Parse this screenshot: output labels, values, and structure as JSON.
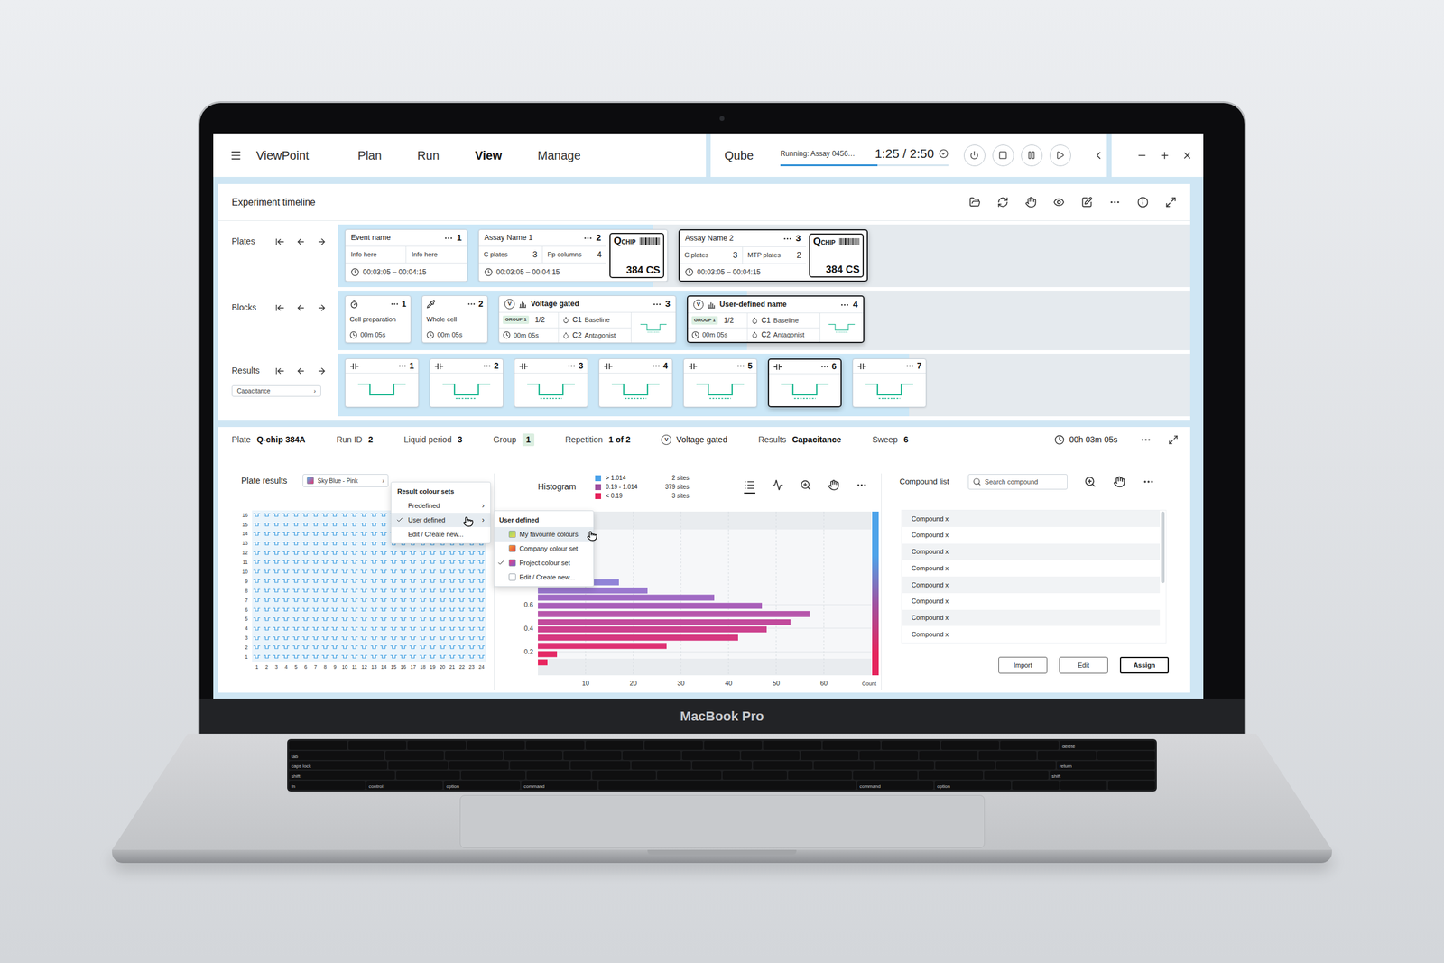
{
  "device": {
    "label": "MacBook Pro"
  },
  "keyboard": {
    "rows": [
      [
        "",
        "",
        "",
        "",
        "",
        "",
        "",
        "",
        "",
        "",
        "",
        "",
        "",
        "delete"
      ],
      [
        "tab",
        "",
        "",
        "",
        "",
        "",
        "",
        "",
        "",
        "",
        "",
        "",
        "",
        ""
      ],
      [
        "caps lock",
        "",
        "",
        "",
        "",
        "",
        "",
        "",
        "",
        "",
        "",
        "",
        "return"
      ],
      [
        "shift",
        "",
        "",
        "",
        "",
        "",
        "",
        "",
        "",
        "",
        "",
        "shift"
      ],
      [
        "fn",
        "control",
        "option",
        "command",
        "",
        "command",
        "option",
        "",
        "",
        ""
      ]
    ]
  },
  "topbar": {
    "app_name": "ViewPoint",
    "nav": [
      {
        "label": "Plan",
        "selected": false
      },
      {
        "label": "Run",
        "selected": false
      },
      {
        "label": "View",
        "selected": true
      },
      {
        "label": "Manage",
        "selected": false
      }
    ],
    "instrument": "Qube",
    "running": {
      "text": "Running: Assay 0456…",
      "level": 0.58
    },
    "time": "1:25 / 2:50"
  },
  "timeline": {
    "title": "Experiment timeline",
    "plates": {
      "label": "Plates",
      "progress": 0.37,
      "cards": [
        {
          "kind": "event",
          "title": "Event name",
          "number": "1",
          "info": [
            "Info here",
            "Info here"
          ],
          "time": "00:03:05 – 00:04:15",
          "selected": false
        },
        {
          "kind": "assay",
          "title": "Assay Name 1",
          "number": "2",
          "stats": [
            {
              "label": "C plates",
              "value": "3"
            },
            {
              "label": "Pp columns",
              "value": "4"
            }
          ],
          "time": "00:03:05 – 00:04:15",
          "chip": {
            "brand": [
              "Q",
              "CHIP"
            ],
            "label": "384 CS"
          },
          "selected": false
        },
        {
          "kind": "assay",
          "title": "Assay Name 2",
          "number": "3",
          "stats": [
            {
              "label": "C plates",
              "value": "3"
            },
            {
              "label": "MTP plates",
              "value": "2"
            }
          ],
          "time": "00:03:05 – 00:04:15",
          "chip": {
            "brand": [
              "Q",
              "CHIP"
            ],
            "label": "384 CS"
          },
          "selected": true
        }
      ]
    },
    "blocks": {
      "label": "Blocks",
      "progress": 0.48,
      "cards": [
        {
          "kind": "prep",
          "title": "Cell preparation",
          "number": "1",
          "duration": "00m 05s",
          "selected": false
        },
        {
          "kind": "patch",
          "title": "Whole cell",
          "number": "2",
          "duration": "00m 05s",
          "selected": false
        },
        {
          "kind": "assay",
          "badge": "V",
          "title": "Voltage gated",
          "number": "3",
          "group": "GROUP 1",
          "fraction": "1/2",
          "compounds": [
            {
              "id": "C1",
              "name": "Baseline"
            },
            {
              "id": "C2",
              "name": "Antagonist"
            }
          ],
          "duration": "00m 05s",
          "dashed": true,
          "selected": false
        },
        {
          "kind": "assay",
          "badge": "V",
          "title": "User-defined name",
          "number": "4",
          "group": "GROUP 1",
          "fraction": "1/2",
          "compounds": [
            {
              "id": "C1",
              "name": "Baseline"
            },
            {
              "id": "C2",
              "name": "Antagonist"
            }
          ],
          "duration": "00m 05s",
          "dashed": true,
          "selected": true
        }
      ]
    },
    "results": {
      "label": "Results",
      "progress": 0.67,
      "selector": {
        "label": "Capacitance",
        "arrow": "›"
      },
      "cards": [
        {
          "number": "1",
          "dashed": false,
          "selected": false
        },
        {
          "number": "2",
          "dashed": true,
          "selected": false
        },
        {
          "number": "3",
          "dashed": true,
          "selected": false
        },
        {
          "number": "4",
          "dashed": true,
          "selected": false
        },
        {
          "number": "5",
          "dashed": true,
          "selected": false
        },
        {
          "number": "6",
          "dashed": true,
          "selected": true
        },
        {
          "number": "7",
          "dashed": true,
          "selected": false
        }
      ]
    }
  },
  "plate_view": {
    "fields": [
      {
        "kind": "pair",
        "label": "Plate",
        "value": "Q-chip 384A"
      },
      {
        "kind": "pair",
        "label": "Run ID",
        "value": "2"
      },
      {
        "kind": "pair",
        "label": "Liquid period",
        "value": "3"
      },
      {
        "kind": "badge",
        "label": "Group",
        "value": "1"
      },
      {
        "kind": "pair",
        "label": "Repetition",
        "value": "1 of 2"
      },
      {
        "kind": "mode",
        "badge": "V",
        "value": "Voltage gated"
      },
      {
        "kind": "pair",
        "label": "Results",
        "value": "Capacitance"
      },
      {
        "kind": "pair",
        "label": "Sweep",
        "value": "6"
      }
    ],
    "duration": "00h 03m 05s"
  },
  "plate_results": {
    "title": "Plate results",
    "colour_set": {
      "label": "Sky Blue - Pink",
      "arrow": "›",
      "swatch": [
        "#5aaeea",
        "#e5326e"
      ]
    },
    "rows": [
      "16",
      "15",
      "14",
      "13",
      "12",
      "11",
      "10",
      "9",
      "8",
      "7",
      "6",
      "5",
      "4",
      "3",
      "2",
      "1"
    ],
    "columns": [
      "1",
      "2",
      "3",
      "4",
      "5",
      "6",
      "7",
      "8",
      "9",
      "10",
      "11",
      "12",
      "13",
      "14",
      "15",
      "16",
      "17",
      "18",
      "19",
      "20",
      "21",
      "22",
      "23",
      "24"
    ]
  },
  "colour_menu": {
    "title": "Result colour sets",
    "items": [
      {
        "label": "Predefined",
        "arrow": "›",
        "checked": false,
        "highlighted": false
      },
      {
        "label": "User defined",
        "arrow": "›",
        "checked": true,
        "highlighted": true
      },
      {
        "label": "Edit / Create new...",
        "arrow": "",
        "checked": false,
        "highlighted": false
      }
    ]
  },
  "colour_submenu": {
    "title": "User defined",
    "items": [
      {
        "label": "My favourite colours",
        "checked": false,
        "highlighted": true,
        "swatch": [
          "#8fd46b",
          "#f3dc4f"
        ]
      },
      {
        "label": "Company colour set",
        "checked": false,
        "highlighted": false,
        "swatch": [
          "#f6a03a",
          "#e23d3d"
        ]
      },
      {
        "label": "Project colour set",
        "checked": true,
        "highlighted": false,
        "swatch": [
          "#ea3f78",
          "#7b5fd3"
        ]
      },
      {
        "label": "Edit / Create new...",
        "checked": false,
        "highlighted": false,
        "swatch": []
      }
    ]
  },
  "histogram": {
    "title": "Histogram",
    "legend": [
      {
        "range": "> 1.014",
        "count": "2 sites",
        "color": "#4da3ea"
      },
      {
        "range": "0.19 - 1.014",
        "count": "379 sites",
        "color": "#a0519f"
      },
      {
        "range": "< 0.19",
        "count": "3 sites",
        "color": "#e5245c"
      }
    ],
    "view_modes": [
      {
        "selected": true
      },
      {
        "selected": false
      }
    ],
    "x_range": [
      0,
      70
    ],
    "y_range": [
      0,
      1.39
    ],
    "x_ticks": [
      "10",
      "20",
      "30",
      "40",
      "50",
      "60"
    ],
    "x_label": "Count",
    "y_ticks": [
      "0.2",
      "0.4",
      "0.6"
    ],
    "bars": [
      {
        "bin": 0.79,
        "value": 17,
        "color": "#9184d8"
      },
      {
        "bin": 0.72,
        "value": 23,
        "color": "#9a78cf"
      },
      {
        "bin": 0.66,
        "value": 37,
        "color": "#a06ac4"
      },
      {
        "bin": 0.59,
        "value": 47,
        "color": "#a95fb9"
      },
      {
        "bin": 0.52,
        "value": 57,
        "color": "#b655ab"
      },
      {
        "bin": 0.45,
        "value": 53,
        "color": "#c24a9c"
      },
      {
        "bin": 0.39,
        "value": 48,
        "color": "#cc418e"
      },
      {
        "bin": 0.32,
        "value": 42,
        "color": "#d6387f"
      },
      {
        "bin": 0.25,
        "value": 27,
        "color": "#de3072"
      },
      {
        "bin": 0.18,
        "value": 4,
        "color": "#e42a66"
      },
      {
        "bin": 0.11,
        "value": 2,
        "color": "#e8255e"
      }
    ],
    "colour_scale": [
      {
        "at": 1.39,
        "color": "#4da3ea"
      },
      {
        "at": 1.014,
        "color": "#4da3ea"
      },
      {
        "at": 0.6,
        "color": "#a0519f"
      },
      {
        "at": 0.19,
        "color": "#e5245c"
      },
      {
        "at": 0,
        "color": "#e5245c"
      }
    ]
  },
  "compound_list": {
    "title": "Compound list",
    "search": {
      "placeholder": "Search compound"
    },
    "items": [
      "Compound x",
      "Compound x",
      "Compound x",
      "Compound x",
      "Compound x",
      "Compound x",
      "Compound x",
      "Compound x"
    ],
    "scrollbar": {
      "level": 0.55
    },
    "buttons": [
      {
        "label": "Import",
        "primary": false
      },
      {
        "label": "Edit",
        "primary": false
      },
      {
        "label": "Assign",
        "primary": true
      }
    ]
  }
}
